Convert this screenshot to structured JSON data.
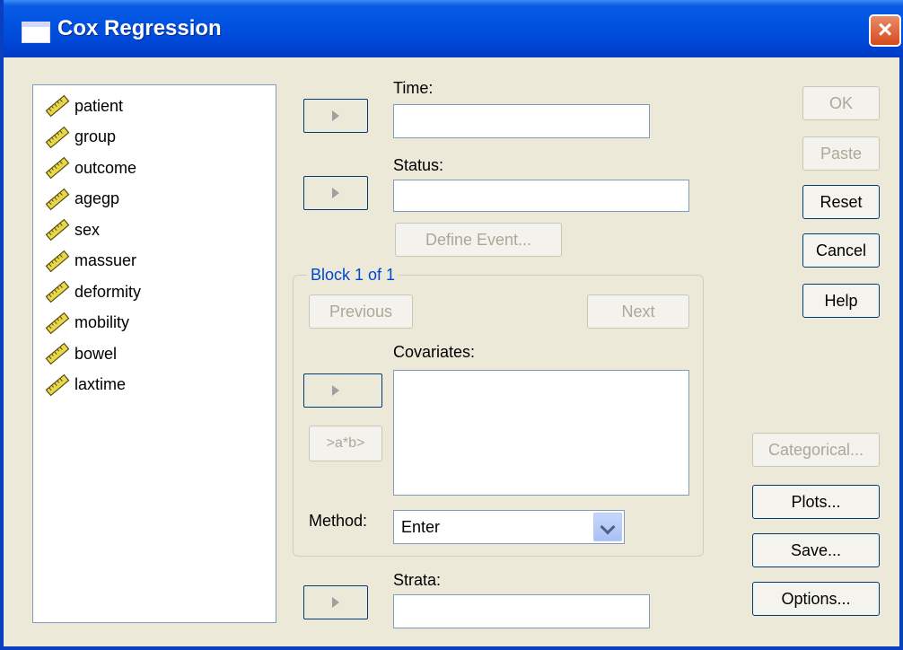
{
  "window": {
    "title": "Cox Regression",
    "close": "×"
  },
  "variables": [
    "patient",
    "group",
    "outcome",
    "agegp",
    "sex",
    "massuer",
    "deformity",
    "mobility",
    "bowel",
    "laxtime"
  ],
  "fields": {
    "time_label": "Time:",
    "status_label": "Status:",
    "covariates_label": "Covariates:",
    "method_label": "Method:",
    "strata_label": "Strata:"
  },
  "buttons": {
    "define_event": "Define Event...",
    "previous": "Previous",
    "next": "Next",
    "interaction": ">a*b>",
    "ok": "OK",
    "paste": "Paste",
    "reset": "Reset",
    "cancel": "Cancel",
    "help": "Help",
    "categorical": "Categorical...",
    "plots": "Plots...",
    "save": "Save...",
    "options": "Options..."
  },
  "block": {
    "label": "Block 1 of 1"
  },
  "method": {
    "selected": "Enter"
  },
  "icons": {
    "variable": "ruler-scale-icon",
    "arrow": "right-arrow-icon",
    "dropdown": "chevron-down-icon"
  },
  "colors": {
    "titlebar": "#0053e1",
    "block_label": "#0046d5",
    "close": "#d54a1d"
  }
}
